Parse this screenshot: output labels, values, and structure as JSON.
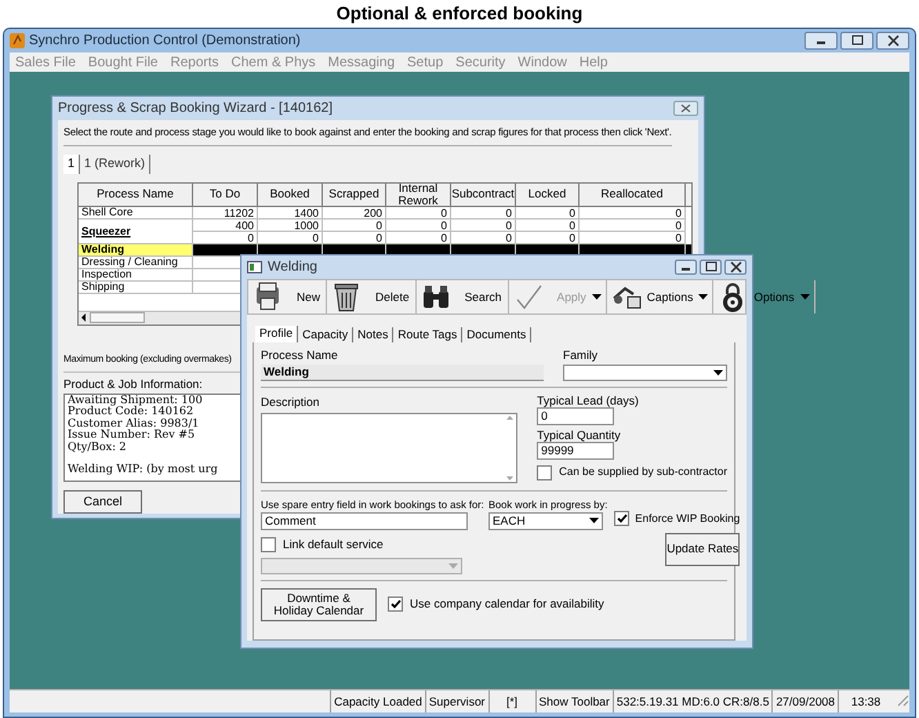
{
  "page_caption": "Optional & enforced booking",
  "window": {
    "title": "Synchro Production Control (Demonstration)"
  },
  "menu": [
    {
      "label": "Sales File",
      "disabled": true
    },
    {
      "label": "Bought File",
      "disabled": true
    },
    {
      "label": "Reports",
      "disabled": true
    },
    {
      "label": "Chem & Phys",
      "disabled": true
    },
    {
      "label": "Messaging",
      "disabled": true
    },
    {
      "label": "Setup",
      "disabled": true
    },
    {
      "label": "Security",
      "disabled": true
    },
    {
      "label": "Window",
      "disabled": true
    },
    {
      "label": "Help",
      "disabled": true
    }
  ],
  "wizard": {
    "title": "Progress & Scrap Booking Wizard - [140162]",
    "instruction": "Select the route and process stage you would like to book against and enter the booking and scrap figures for that process then click 'Next'.",
    "tabs": [
      {
        "label": "1",
        "selected": true
      },
      {
        "label": "1 (Rework)",
        "selected": false
      }
    ],
    "columns": [
      "Process Name",
      "To Do",
      "Booked",
      "Scrapped",
      "Internal Rework",
      "Subcontract",
      "Locked",
      "Reallocated"
    ],
    "rows": [
      {
        "process": "Shell Core",
        "bold": false,
        "selected": false,
        "lines": [
          [
            "11202",
            "1400",
            "200",
            "0",
            "0",
            "0",
            "0"
          ]
        ]
      },
      {
        "process": "Squeezer",
        "bold": true,
        "selected": false,
        "lines": [
          [
            "400",
            "1000",
            "0",
            "0",
            "0",
            "0",
            "0"
          ],
          [
            "0",
            "0",
            "0",
            "0",
            "0",
            "0",
            "0"
          ]
        ]
      },
      {
        "process": "Welding",
        "bold": true,
        "selected": true
      },
      {
        "process": "Dressing / Cleaning",
        "bold": false,
        "selected": false
      },
      {
        "process": "Inspection",
        "bold": false,
        "selected": false
      },
      {
        "process": "Shipping",
        "bold": false,
        "selected": false
      }
    ],
    "max_booking": "Maximum booking (excluding overmakes)",
    "info_label": "Product & Job Information:",
    "info_blocks": [
      [
        "Awaiting Shipment: 100",
        "Product Code: 140162",
        "Customer Alias: 9983/1",
        "Issue Number: Rev #5",
        "Qty/Box: 2"
      ],
      [
        "Welding WIP: (by most urg"
      ]
    ],
    "cancel": "Cancel"
  },
  "welding": {
    "title": "Welding",
    "toolbar": [
      {
        "kind": "new",
        "label": "New",
        "disabled": false,
        "dropdown": false
      },
      {
        "kind": "delete",
        "label": "Delete",
        "disabled": false,
        "dropdown": false
      },
      {
        "kind": "search",
        "label": "Search",
        "disabled": false,
        "dropdown": false
      },
      {
        "kind": "apply",
        "label": "Apply",
        "disabled": true,
        "dropdown": true
      },
      {
        "kind": "captions",
        "label": "Captions",
        "disabled": false,
        "dropdown": true
      },
      {
        "kind": "options",
        "label": "Options",
        "disabled": false,
        "dropdown": true
      }
    ],
    "tabs": [
      {
        "label": "Profile",
        "selected": true
      },
      {
        "label": "Capacity",
        "selected": false
      },
      {
        "label": "Notes",
        "selected": false
      },
      {
        "label": "Route Tags",
        "selected": false
      },
      {
        "label": "Documents",
        "selected": false
      }
    ],
    "process_name_label": "Process Name",
    "process_name": "Welding",
    "family_label": "Family",
    "description_label": "Description",
    "typical_lead_label": "Typical Lead (days)",
    "typical_lead": "0",
    "typical_quantity_label": "Typical Quantity",
    "typical_quantity": "99999",
    "subcontractor": {
      "label": "Can be supplied by sub-contractor",
      "checked": false
    },
    "spare_label": "Use spare entry field in work bookings to ask for:",
    "spare_value": "Comment",
    "wip_label": "Book work in progress by:",
    "wip_value": "EACH",
    "enforce_wip": {
      "label": "Enforce WIP Booking",
      "checked": true
    },
    "link_service": {
      "label": "Link default service",
      "checked": false
    },
    "update_rates": "Update Rates",
    "downtime": "Downtime & Holiday Calendar",
    "company_calendar": {
      "label": "Use company calendar for availability",
      "checked": true
    }
  },
  "status_bar": [
    "Capacity Loaded",
    "Supervisor",
    "[*]",
    "Show Toolbar",
    "532:5.19.31 MD:6.0 CR:8/8.5",
    "27/09/2008",
    "13:38"
  ]
}
